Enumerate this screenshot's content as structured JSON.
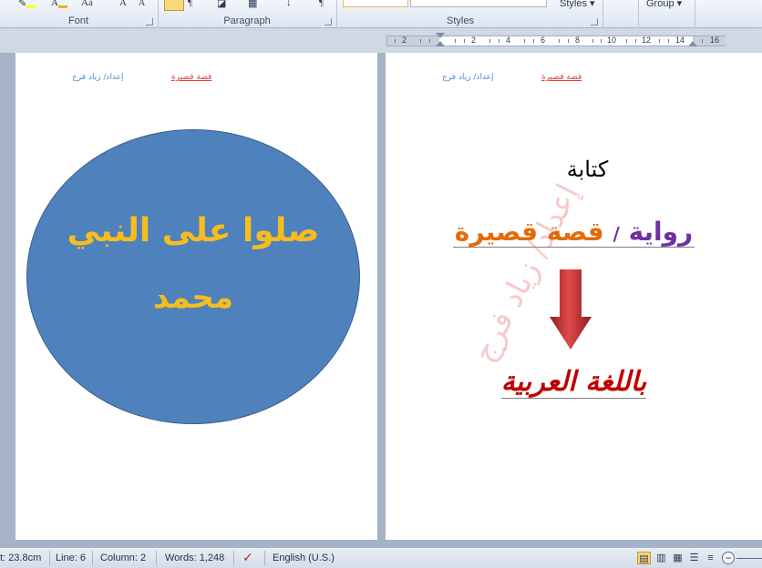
{
  "ribbon": {
    "groups": {
      "font": "Font",
      "paragraph": "Paragraph",
      "styles": "Styles",
      "group": "Group"
    },
    "font_icons": {
      "change_case": "Aa",
      "grow": "A",
      "shrink": "A"
    },
    "styles_button": "Styles",
    "group_button": "Group"
  },
  "ruler": {
    "numbers": [
      "2",
      "2",
      "4",
      "6",
      "8",
      "10",
      "12",
      "14",
      "16"
    ]
  },
  "left_page": {
    "header_title": "قصة قصيرة",
    "header_author": "إعداد/ زياد فرج",
    "ellipse_line1": "صلوا على النبي",
    "ellipse_line2": "محمد"
  },
  "right_page": {
    "header_title": "قصة قصيرة",
    "header_author": "إعداد/ زياد فرج",
    "writing": "كتابة",
    "novel": "رواية",
    "slash": "/",
    "short_story": "قصة قصيرة",
    "arabic_language": "باللغة العربية",
    "watermark": "إعداد/ زياد فرج"
  },
  "status_bar": {
    "at": "t: 23.8cm",
    "line": "Line: 6",
    "column": "Column: 2",
    "words": "Words: 1,248",
    "language": "English (U.S.)"
  },
  "icons": {
    "highlight": "text-highlight-icon",
    "font_color": "font-color-icon",
    "spelling": "spelling-check-icon",
    "arrow": "down-arrow-icon"
  },
  "colors": {
    "ellipse_fill": "#4f81bd",
    "ellipse_text": "#f7bd1e",
    "novel": "#7030a0",
    "short_story": "#e36c0a",
    "arrow": "#c0282b",
    "arabic_language": "#c00000"
  }
}
